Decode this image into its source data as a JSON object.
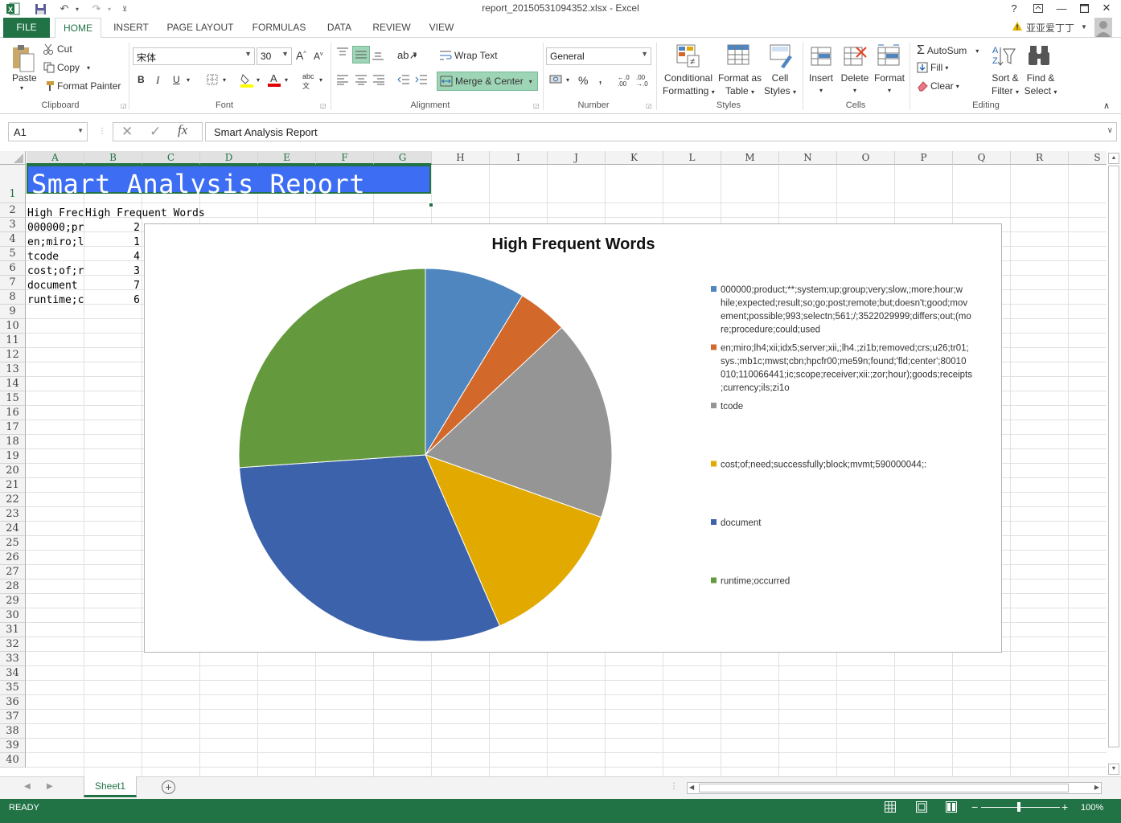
{
  "titlebar": {
    "title": "report_20150531094352.xlsx - Excel",
    "help": "?",
    "minimize": "—",
    "close": "✕"
  },
  "tabs": {
    "file": "FILE",
    "items": [
      "HOME",
      "INSERT",
      "PAGE LAYOUT",
      "FORMULAS",
      "DATA",
      "REVIEW",
      "VIEW"
    ],
    "user": "亚亚爱丁丁"
  },
  "ribbon": {
    "clipboard": {
      "label": "Clipboard",
      "paste": "Paste",
      "cut": "Cut",
      "copy": "Copy",
      "format_painter": "Format Painter"
    },
    "font": {
      "label": "Font",
      "name": "宋体",
      "size": "30",
      "bold": "B",
      "italic": "I",
      "underline": "U"
    },
    "alignment": {
      "label": "Alignment",
      "wrap_text": "Wrap Text",
      "merge_center": "Merge & Center"
    },
    "number": {
      "label": "Number",
      "format": "General",
      "percent": "%",
      "comma": ","
    },
    "styles": {
      "label": "Styles",
      "conditional": "Conditional",
      "conditional2": "Formatting",
      "format_as": "Format as",
      "format_as2": "Table",
      "cell": "Cell",
      "cell2": "Styles"
    },
    "cells": {
      "label": "Cells",
      "insert": "Insert",
      "delete": "Delete",
      "format": "Format"
    },
    "editing": {
      "label": "Editing",
      "autosum": "AutoSum",
      "fill": "Fill",
      "clear": "Clear",
      "sort": "Sort &",
      "sort2": "Filter",
      "find": "Find &",
      "find2": "Select"
    }
  },
  "formula_bar": {
    "name_box": "A1",
    "fx": "fx",
    "value": "Smart Analysis Report"
  },
  "columns": [
    "A",
    "B",
    "C",
    "D",
    "E",
    "F",
    "G",
    "H",
    "I",
    "J",
    "K",
    "L",
    "M",
    "N",
    "O",
    "P",
    "Q",
    "R",
    "S"
  ],
  "rows": [
    "1",
    "2",
    "3",
    "4",
    "5",
    "6",
    "7",
    "8",
    "9",
    "10",
    "11",
    "12",
    "13",
    "14",
    "15",
    "16",
    "17",
    "18",
    "19",
    "20",
    "21",
    "22",
    "23",
    "24",
    "25",
    "26",
    "27",
    "28",
    "29",
    "30",
    "31",
    "32",
    "33",
    "34",
    "35",
    "36",
    "37",
    "38",
    "39",
    "40"
  ],
  "cells": {
    "a1": "Smart Analysis Report",
    "a2": "High Frec",
    "b2": "High Frequent Words",
    "a3": "000000;pr",
    "b3": "2",
    "a4": "en;miro;l",
    "b4": "1",
    "a5": "tcode",
    "b5": "4",
    "a6": "cost;of;r",
    "b6": "3",
    "a7": "document",
    "b7": "7",
    "a8": "runtime;c",
    "b8": "6"
  },
  "chart_data": {
    "type": "pie",
    "title": "High Frequent Words",
    "categories": [
      "000000;product;**;system;up;group;very;slow,;more;hour;while;expected;result;so;go;post;remote;but;doesn't;good;movement;possible;993;selectn;561;/;3522029999;differs;out;(more;procedure;could;used",
      "en;miro;lh4;xii;idx5;server;xii,;lh4.;zi1b;removed;crs;u26;tr01;sys.;mb1c;mwst;cbn;hpcfr00;me59n;found;'fld;center';80010010;110066441;ic;scope;receiver;xii:;zor;hour);goods;receipts;currency;ils;zi1o",
      "tcode",
      "cost;of;need;successfully;block;mvmt;590000044;:",
      "document",
      "runtime;occurred"
    ],
    "values": [
      2,
      1,
      4,
      3,
      7,
      6
    ],
    "colors": [
      "#4f86c0",
      "#d2692a",
      "#959595",
      "#e2aa00",
      "#3c62ab",
      "#64993d"
    ],
    "legend_position": "right"
  },
  "legend_lines": [
    [
      "000000;product;**;system;up;group;very;slow,;more;hour;w",
      "hile;expected;result;so;go;post;remote;but;doesn't;good;mov",
      "ement;possible;993;selectn;561;/;3522029999;differs;out;(mo",
      "re;procedure;could;used"
    ],
    [
      "en;miro;lh4;xii;idx5;server;xii,;lh4.;zi1b;removed;crs;u26;tr01;",
      "sys.;mb1c;mwst;cbn;hpcfr00;me59n;found;'fld;center';80010",
      "010;110066441;ic;scope;receiver;xii:;zor;hour);goods;receipts",
      ";currency;ils;zi1o"
    ],
    [
      "tcode"
    ],
    [
      "cost;of;need;successfully;block;mvmt;590000044;:"
    ],
    [
      "document"
    ],
    [
      "runtime;occurred"
    ]
  ],
  "sheet_tabs": [
    "Sheet1"
  ],
  "status": {
    "ready": "READY",
    "zoom": "100%"
  }
}
